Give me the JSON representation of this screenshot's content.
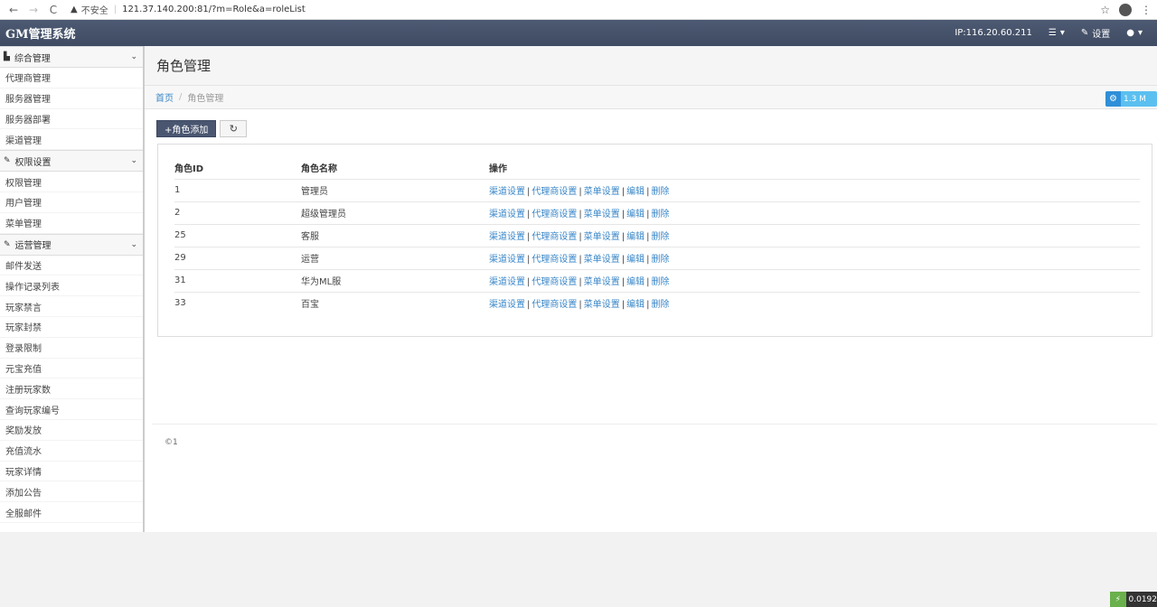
{
  "browser": {
    "insecure_label": "不安全",
    "url": "121.37.140.200:81/?m=Role&a=roleList"
  },
  "topbar": {
    "brand": "GM管理系统",
    "ip": "IP:116.20.60.211",
    "settings": "设置"
  },
  "sidebar": {
    "groups": [
      {
        "title": "综合管理",
        "items": [
          "代理商管理",
          "服务器管理",
          "服务器部署",
          "渠道管理"
        ]
      },
      {
        "title": "权限设置",
        "items": [
          "权限管理",
          "用户管理",
          "菜单管理"
        ]
      },
      {
        "title": "运营管理",
        "items": [
          "邮件发送",
          "操作记录列表",
          "玩家禁言",
          "玩家封禁",
          "登录限制",
          "元宝充值",
          "注册玩家数",
          "查询玩家编号",
          "奖励发放",
          "充值流水",
          "玩家详情",
          "添加公告",
          "全服邮件"
        ]
      }
    ]
  },
  "page": {
    "title": "角色管理",
    "breadcrumb_home": "首页",
    "breadcrumb_current": "角色管理",
    "mem_badge": "1.3 M",
    "add_button": "+角色添加"
  },
  "table": {
    "headers": [
      "角色ID",
      "角色名称",
      "操作"
    ],
    "rows": [
      {
        "id": "1",
        "name": "管理员"
      },
      {
        "id": "2",
        "name": "超级管理员"
      },
      {
        "id": "25",
        "name": "客服"
      },
      {
        "id": "29",
        "name": "运营"
      },
      {
        "id": "31",
        "name": "华为ML服"
      },
      {
        "id": "33",
        "name": "百宝"
      }
    ],
    "ops": [
      "渠道设置",
      "代理商设置",
      "菜单设置",
      "编辑",
      "删除"
    ]
  },
  "footer": {
    "text": "©1"
  },
  "timer": {
    "text": "0.0192"
  }
}
